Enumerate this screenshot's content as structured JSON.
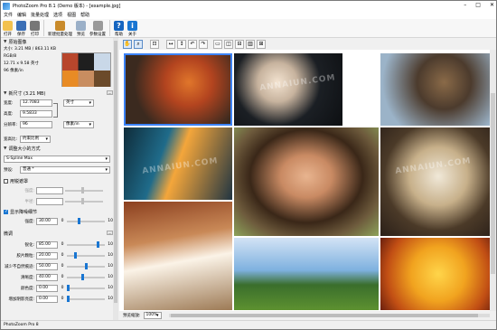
{
  "window": {
    "title": "PhotoZoom Pro 8.1 (Demo 版本) - [example.jpg]"
  },
  "menu": [
    "文件",
    "编辑",
    "批量处理",
    "选项",
    "视图",
    "帮助"
  ],
  "toolbar": [
    {
      "id": "open",
      "label": "打开",
      "icon": "folder-open-icon"
    },
    {
      "id": "save",
      "label": "保存",
      "icon": "save-icon"
    },
    {
      "id": "print",
      "label": "打印",
      "icon": "print-icon"
    },
    {
      "id": "batch",
      "label": "新建批量处理",
      "icon": "batch-icon"
    },
    {
      "id": "preview",
      "label": "预览",
      "icon": "preview-icon"
    },
    {
      "id": "settings",
      "label": "参数设置",
      "icon": "settings-icon"
    },
    {
      "id": "help",
      "label": "帮助",
      "icon": "help-icon"
    },
    {
      "id": "about",
      "label": "关于",
      "icon": "info-icon"
    }
  ],
  "left": {
    "original_section": "原始图像",
    "size_info": "大小: 3.21 MB / 863.11 KB",
    "color_mode": "RGB/8",
    "dimensions": "12.71 x 9.58 英寸",
    "resolution": "96 像素/in",
    "new_size_section": "新尺寸 (3.21 MB)",
    "width_label": "宽度:",
    "width_value": "12.7083",
    "width_unit": "英寸",
    "height_label": "高度:",
    "height_value": "9.5833",
    "res_label": "分辨率:",
    "res_value": "96",
    "res_unit": "像素/in",
    "fit_label": "宽高比:",
    "fit_value": "约束比例",
    "adjust_section": "调整大小的方式",
    "method_value": "S-Spline Max",
    "preset_label": "预设:",
    "preset_value": "普通 *",
    "unsharp_label": "用锐遮罩",
    "strength_label": "强度:",
    "radius_label": "半径:",
    "photo_label": "显示降噪细节",
    "strength2_label": "强度:",
    "strength2_value": "30.00",
    "fine_section": "微调",
    "sharp_label": "锐化:",
    "sharp_value": "85.00",
    "film_label": "胶片颗粒:",
    "film_value": "20.00",
    "artifact_label": "减少不自然痕迹:",
    "artifact_value": "50.00",
    "clarity_label": "清晰度:",
    "clarity_value": "40.00",
    "vibrance_label": "颜色度:",
    "vibrance_value": "0.00",
    "hdr_label": "增加阴影亮度:",
    "hdr_value": "0.00",
    "min": "0",
    "max": "100"
  },
  "progress": {
    "strength2": 0.3,
    "sharp": 0.85,
    "film": 0.2,
    "artifact": 0.5,
    "clarity": 0.4,
    "vibrance": 0.0,
    "hdr": 0.0
  },
  "main": {
    "zoom_label": "预览缩放:",
    "zoom_value": "100%"
  },
  "status": {
    "text": "PhotoZoom Pro 8"
  },
  "watermark": "ANNAIUN.COM"
}
